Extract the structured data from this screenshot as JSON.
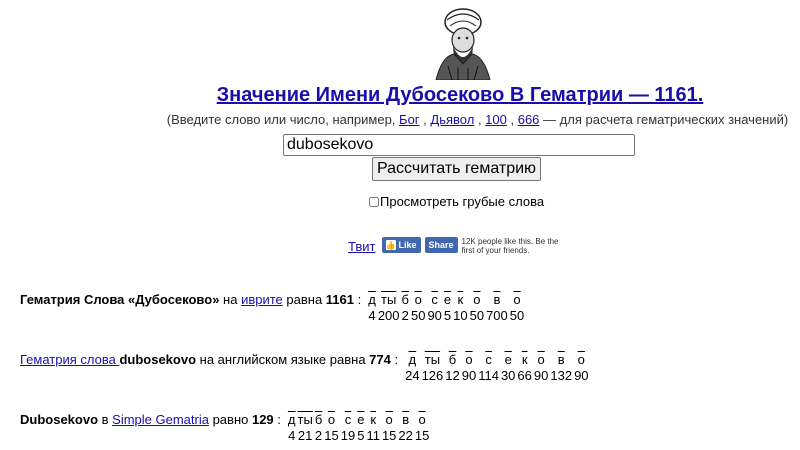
{
  "header": {
    "title": "Значение Имени Дубосеково В Гематрии — 1161.",
    "hint_prefix": "(Введите слово или число, например,",
    "hint_links": [
      "Бог",
      "Дьявол",
      "100",
      "666"
    ],
    "hint_suffix": "— для расчета гематрических значений)"
  },
  "search": {
    "value": "dubosekovo",
    "button_label": "Рассчитать гематрию",
    "rude_label": "Просмотреть грубые слова"
  },
  "social": {
    "tweet_label": "Твит",
    "like_label": "Like",
    "share_label": "Share",
    "like_count_text": "12K people like this. Be the first of your friends."
  },
  "results": {
    "hebrew": {
      "bold_prefix": "Гематрия Слова «Дубосеково»",
      "mid_text": " на ",
      "link": "иврите",
      "after_link": " равна ",
      "value": "1161",
      "colon": " :",
      "letters": [
        {
          "ch": "д",
          "val": "4"
        },
        {
          "ch": "ты",
          "val": "200"
        },
        {
          "ch": "б",
          "val": "2"
        },
        {
          "ch": "о",
          "val": "50"
        },
        {
          "ch": "с",
          "val": "90"
        },
        {
          "ch": "е",
          "val": "5"
        },
        {
          "ch": "к",
          "val": "10"
        },
        {
          "ch": "о",
          "val": "50"
        },
        {
          "ch": "в",
          "val": "700"
        },
        {
          "ch": "о",
          "val": "50"
        }
      ]
    },
    "english": {
      "link": "Гематрия слова ",
      "bold_word": "dubosekovo",
      "after": " на английском языке равна ",
      "value": "774",
      "colon": " :",
      "letters": [
        {
          "ch": "д",
          "val": "24"
        },
        {
          "ch": "ты",
          "val": "126"
        },
        {
          "ch": "б",
          "val": "12"
        },
        {
          "ch": "о",
          "val": "90"
        },
        {
          "ch": "с",
          "val": "114"
        },
        {
          "ch": "е",
          "val": "30"
        },
        {
          "ch": "к",
          "val": "66"
        },
        {
          "ch": "о",
          "val": "90"
        },
        {
          "ch": "в",
          "val": "132"
        },
        {
          "ch": "о",
          "val": "90"
        }
      ]
    },
    "simple": {
      "bold_word": "Dubosekovo",
      "mid": " в ",
      "link": "Simple Gematria",
      "after": " равно ",
      "value": "129",
      "colon": " :",
      "letters": [
        {
          "ch": "д",
          "val": "4"
        },
        {
          "ch": "ты",
          "val": "21"
        },
        {
          "ch": "б",
          "val": "2"
        },
        {
          "ch": "о",
          "val": "15"
        },
        {
          "ch": "с",
          "val": "19"
        },
        {
          "ch": "е",
          "val": "5"
        },
        {
          "ch": "к",
          "val": "11"
        },
        {
          "ch": "о",
          "val": "15"
        },
        {
          "ch": "в",
          "val": "22"
        },
        {
          "ch": "о",
          "val": "15"
        }
      ]
    }
  }
}
